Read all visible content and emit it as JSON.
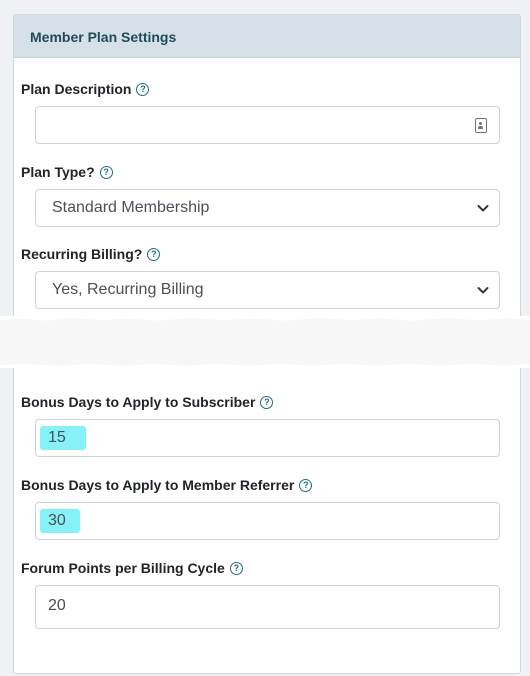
{
  "panel": {
    "title": "Member Plan Settings"
  },
  "fields": {
    "plan_description": {
      "label": "Plan Description",
      "value": ""
    },
    "plan_type": {
      "label": "Plan Type?",
      "selected": "Standard Membership"
    },
    "recurring_billing": {
      "label": "Recurring Billing?",
      "selected": "Yes, Recurring Billing"
    },
    "bonus_subscriber": {
      "label": "Bonus Days to Apply to Subscriber",
      "value": "15"
    },
    "bonus_referrer": {
      "label": "Bonus Days to Apply to Member Referrer",
      "value": "30"
    },
    "forum_points": {
      "label": "Forum Points per Billing Cycle",
      "value": "20"
    }
  },
  "colors": {
    "highlight": "#6ff0f4",
    "header_bg": "#d5e1e6",
    "header_text": "#1f4b5d",
    "help_icon": "#1f6f7a"
  },
  "icons": {
    "help": "question-circle-icon",
    "contact": "contact-card-icon",
    "dropdown": "chevron-down-icon"
  }
}
